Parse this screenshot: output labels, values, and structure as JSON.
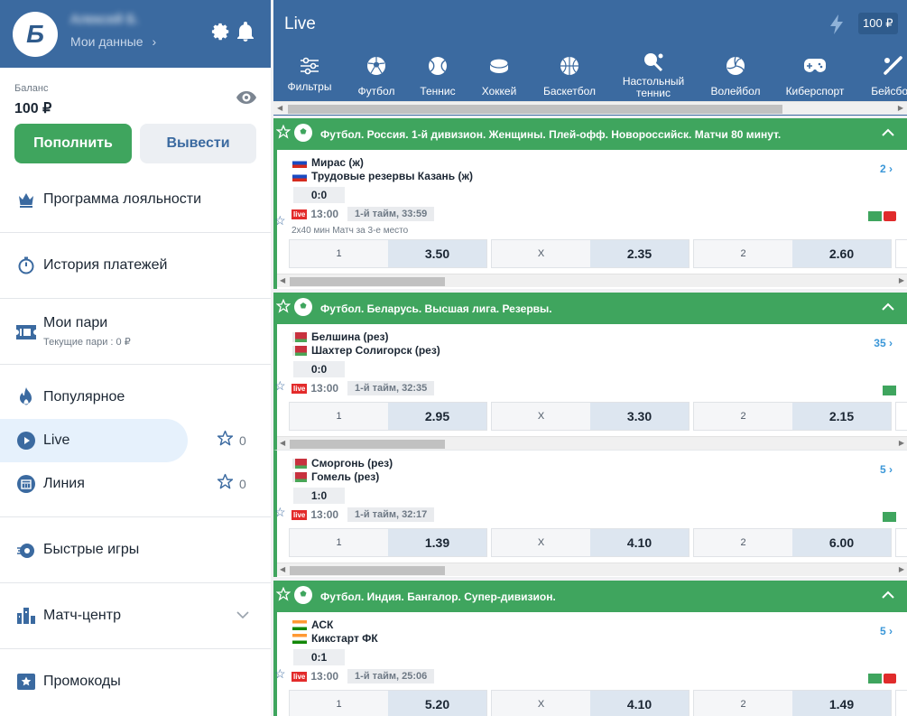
{
  "profile": {
    "name": "Алексей Б.",
    "my_data": "Мои данные"
  },
  "balance": {
    "label": "Баланс",
    "value": "100 ₽"
  },
  "buttons": {
    "deposit": "Пополнить",
    "withdraw": "Вывести"
  },
  "menu": {
    "loyalty": "Программа лояльности",
    "payments": "История платежей",
    "my_bets": "Мои пари",
    "my_bets_sub": "Текущие пари : 0 ₽",
    "popular": "Популярное",
    "live": "Live",
    "live_count": "0",
    "line": "Линия",
    "line_count": "0",
    "fast_games": "Быстрые игры",
    "match_center": "Матч-центр",
    "promo": "Промокоды"
  },
  "main": {
    "title": "Live",
    "balance": "100 ₽"
  },
  "sports": [
    {
      "label": "Фильтры",
      "icon": "filter-icon"
    },
    {
      "label": "Футбол",
      "icon": "soccer-ball-icon"
    },
    {
      "label": "Теннис",
      "icon": "tennis-ball-icon"
    },
    {
      "label": "Хоккей",
      "icon": "hockey-puck-icon"
    },
    {
      "label": "Баскетбол",
      "icon": "basketball-icon"
    },
    {
      "label": "Настольный теннис",
      "icon": "table-tennis-icon"
    },
    {
      "label": "Волейбол",
      "icon": "volleyball-icon"
    },
    {
      "label": "Киберспорт",
      "icon": "gamepad-icon"
    },
    {
      "label": "Бейсбол",
      "icon": "baseball-bat-icon"
    }
  ],
  "sections": [
    {
      "title": "Футбол. Россия. 1-й дивизион. Женщины. Плей-офф. Новороссийск. Матчи 80 минут."
    },
    {
      "title": "Футбол. Беларусь. Высшая лига. Резервы."
    },
    {
      "title": "Футбол. Индия. Бангалор. Супер-дивизион."
    }
  ],
  "events": [
    {
      "team1": "Мирас (ж)",
      "team2": "Трудовые резервы Казань (ж)",
      "score": "0:0",
      "live": "live",
      "time": "13:00",
      "period": "1-й тайм, 33:59",
      "note": "2x40 мин Матч за 3-е место",
      "more": "2",
      "odds": [
        {
          "k": "1",
          "v": "3.50"
        },
        {
          "k": "X",
          "v": "2.35"
        },
        {
          "k": "2",
          "v": "2.60"
        }
      ]
    },
    {
      "team1": "Белшина (рез)",
      "team2": "Шахтер Солигорск (рез)",
      "score": "0:0",
      "live": "live",
      "time": "13:00",
      "period": "1-й тайм, 32:35",
      "more": "35",
      "odds": [
        {
          "k": "1",
          "v": "2.95"
        },
        {
          "k": "X",
          "v": "3.30"
        },
        {
          "k": "2",
          "v": "2.15"
        }
      ]
    },
    {
      "team1": "Сморгонь (рез)",
      "team2": "Гомель (рез)",
      "score": "1:0",
      "live": "live",
      "time": "13:00",
      "period": "1-й тайм, 32:17",
      "more": "5",
      "odds": [
        {
          "k": "1",
          "v": "1.39"
        },
        {
          "k": "X",
          "v": "4.10"
        },
        {
          "k": "2",
          "v": "6.00"
        }
      ]
    },
    {
      "team1": "АСК",
      "team2": "Кикстарт ФК",
      "score": "0:1",
      "live": "live",
      "time": "13:00",
      "period": "1-й тайм, 25:06",
      "more": "5",
      "odds": [
        {
          "k": "1",
          "v": "5.20"
        },
        {
          "k": "X",
          "v": "4.10"
        },
        {
          "k": "2",
          "v": "1.49"
        }
      ]
    }
  ]
}
